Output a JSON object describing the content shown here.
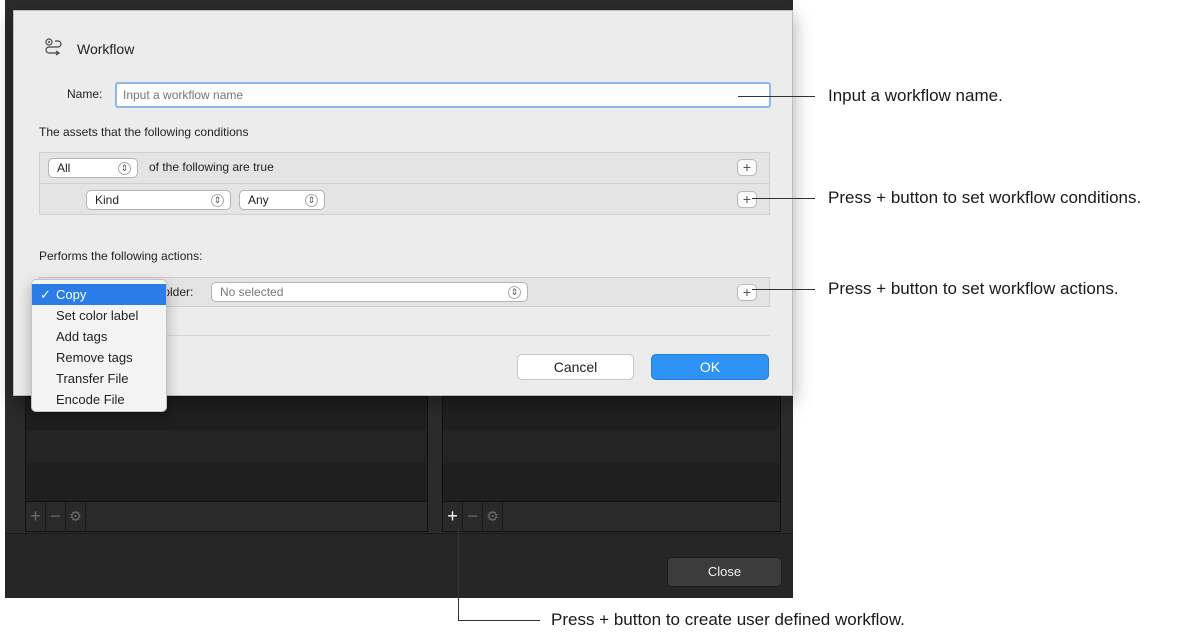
{
  "main_window": {
    "close_label": "Close",
    "left_toolbar": [
      "+",
      "−",
      "⚙"
    ],
    "right_toolbar": [
      "+",
      "−",
      "⚙"
    ]
  },
  "sheet": {
    "title": "Workflow",
    "name_label": "Name:",
    "name_placeholder": "Input a workflow name",
    "name_value": "",
    "conditions_heading": "The assets that the following conditions",
    "match_value": "All",
    "match_suffix": "of the following are true",
    "condition_field": "Kind",
    "condition_operator": "Any",
    "actions_heading": "Performs the following actions:",
    "action_folder_label": "Folder:",
    "action_folder_value": "No selected",
    "cancel_label": "Cancel",
    "ok_label": "OK"
  },
  "action_menu": {
    "selected": "Copy",
    "check": "✓",
    "items": [
      "Copy",
      "Set color label",
      "Add tags",
      "Remove tags",
      "Transfer File",
      "Encode File"
    ]
  },
  "callouts": {
    "name": "Input a workflow name.",
    "conditions": "Press + button to set workflow conditions.",
    "actions": "Press + button to set workflow actions.",
    "create": "Press + button to create user defined workflow."
  },
  "colors": {
    "accent": "#2f93f5",
    "menu_highlight": "#2a7de8",
    "dark_bg": "#2b2b2b"
  },
  "icons": {
    "workflow": "workflow-icon",
    "plus": "plus-icon",
    "minus": "minus-icon",
    "gear": "gear-icon",
    "stepper": "stepper-icon",
    "check": "check-icon"
  }
}
